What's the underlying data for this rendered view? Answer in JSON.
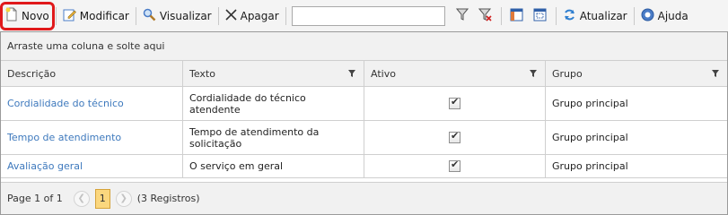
{
  "toolbar": {
    "novo": "Novo",
    "modificar": "Modificar",
    "visualizar": "Visualizar",
    "apagar": "Apagar",
    "search_value": "",
    "atualizar": "Atualizar",
    "ajuda": "Ajuda"
  },
  "grid": {
    "group_panel": "Arraste uma coluna e solte aqui",
    "columns": [
      "Descrição",
      "Texto",
      "Ativo",
      "Grupo"
    ],
    "rows": [
      {
        "descricao": "Cordialidade do técnico",
        "texto": "Cordialidade do técnico atendente",
        "ativo": true,
        "grupo": "Grupo principal"
      },
      {
        "descricao": "Tempo de atendimento",
        "texto": "Tempo de atendimento da solicitação",
        "ativo": true,
        "grupo": "Grupo principal"
      },
      {
        "descricao": "Avaliação geral",
        "texto": "O serviço em geral",
        "ativo": true,
        "grupo": "Grupo principal"
      }
    ]
  },
  "pager": {
    "summary": "Page 1 of 1",
    "current_page": "1",
    "records": "(3 Registros)"
  },
  "colors": {
    "highlight": "#e0191b",
    "link": "#3e79bd",
    "current_page": "#fbd77e"
  }
}
